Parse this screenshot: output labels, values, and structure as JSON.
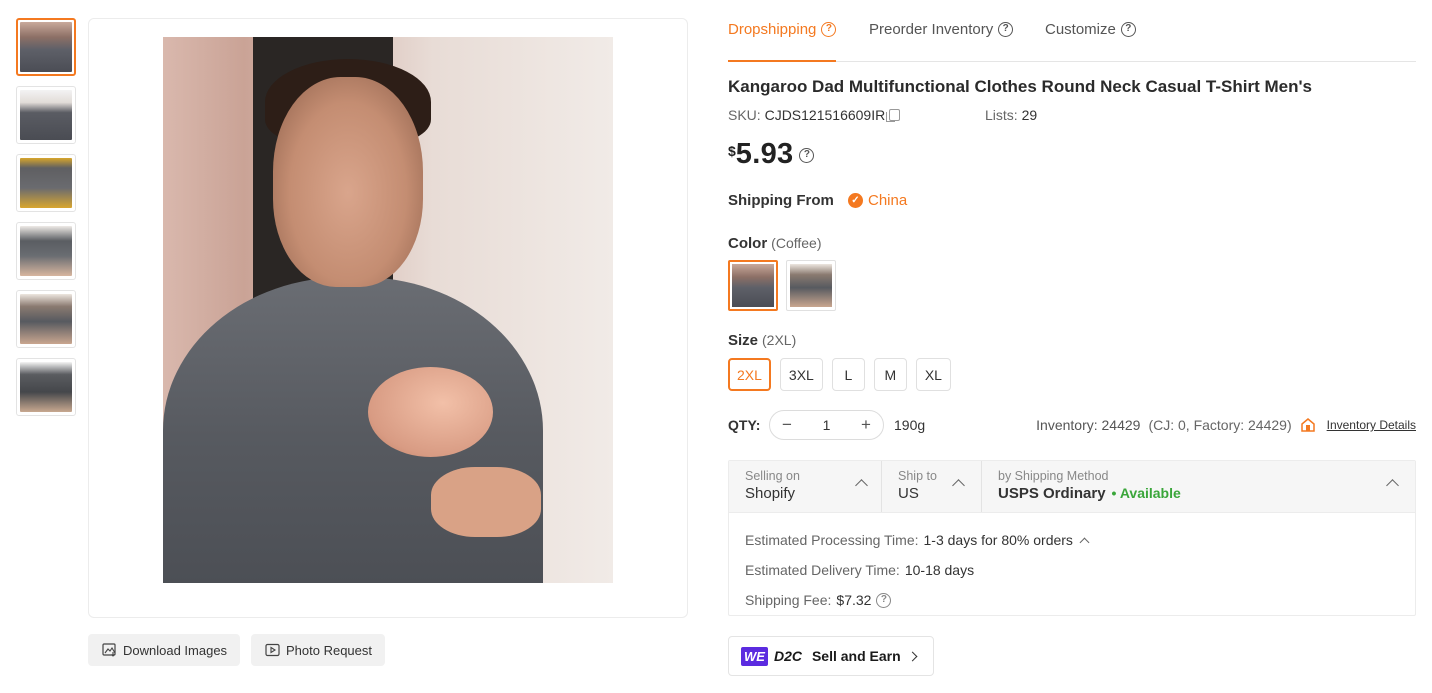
{
  "thumbnails": [
    "thumb-1",
    "thumb-2",
    "thumb-3",
    "thumb-4",
    "thumb-5",
    "thumb-6"
  ],
  "buttons": {
    "download": "Download Images",
    "photo_request": "Photo Request"
  },
  "tabs": [
    {
      "label": "Dropshipping",
      "active": true
    },
    {
      "label": "Preorder Inventory",
      "active": false
    },
    {
      "label": "Customize",
      "active": false
    }
  ],
  "product": {
    "title": "Kangaroo Dad Multifunctional Clothes Round Neck Casual T-Shirt Men's",
    "sku_label": "SKU:",
    "sku": "CJDS121516609IR",
    "lists_label": "Lists:",
    "lists": "29",
    "currency": "$",
    "price": "5.93"
  },
  "shipping_from": {
    "label": "Shipping From",
    "country": "China"
  },
  "color": {
    "label": "Color",
    "selected": "(Coffee)"
  },
  "size": {
    "label": "Size",
    "selected": "(2XL)",
    "options": [
      "2XL",
      "3XL",
      "L",
      "M",
      "XL"
    ]
  },
  "qty": {
    "label": "QTY:",
    "value": "1",
    "weight": "190g"
  },
  "inventory": {
    "text": "Inventory: 24429",
    "detail": "(CJ: 0, Factory: 24429)",
    "link": "Inventory Details"
  },
  "shipping": {
    "selling_on_label": "Selling on",
    "selling_on": "Shopify",
    "ship_to_label": "Ship to",
    "ship_to": "US",
    "method_label": "by Shipping Method",
    "method": "USPS Ordinary",
    "availability": "• Available",
    "processing_label": "Estimated Processing Time:",
    "processing": "1-3 days for 80% orders",
    "delivery_label": "Estimated Delivery Time:",
    "delivery": "10-18 days",
    "fee_label": "Shipping Fee:",
    "fee": "$7.32"
  },
  "d2c": {
    "badge": "WE",
    "brand": "D2C",
    "label": "Sell and Earn"
  },
  "colors": {
    "accent": "#f47920",
    "available": "#3aa63a",
    "badge": "#5b2be0"
  }
}
